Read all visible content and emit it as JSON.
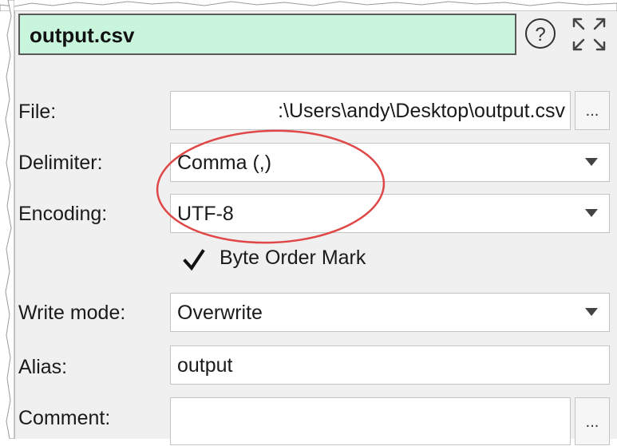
{
  "title": "output.csv",
  "help_icon": "help-circle-icon",
  "expand_icon": "expand-arrows-icon",
  "file": {
    "label": "File:",
    "value": ":\\Users\\andy\\Desktop\\output.csv",
    "browse_label": "..."
  },
  "delimiter": {
    "label": "Delimiter:",
    "value": "Comma (,)"
  },
  "encoding": {
    "label": "Encoding:",
    "value": "UTF-8"
  },
  "bom": {
    "label": "Byte Order Mark",
    "checked": true
  },
  "write_mode": {
    "label": "Write mode:",
    "value": "Overwrite"
  },
  "alias": {
    "label": "Alias:",
    "value": "output"
  },
  "comment": {
    "label": "Comment:",
    "value": "",
    "browse_label": "..."
  },
  "colors": {
    "title_bg": "#c8f5dc",
    "annotation": "#e04848"
  }
}
